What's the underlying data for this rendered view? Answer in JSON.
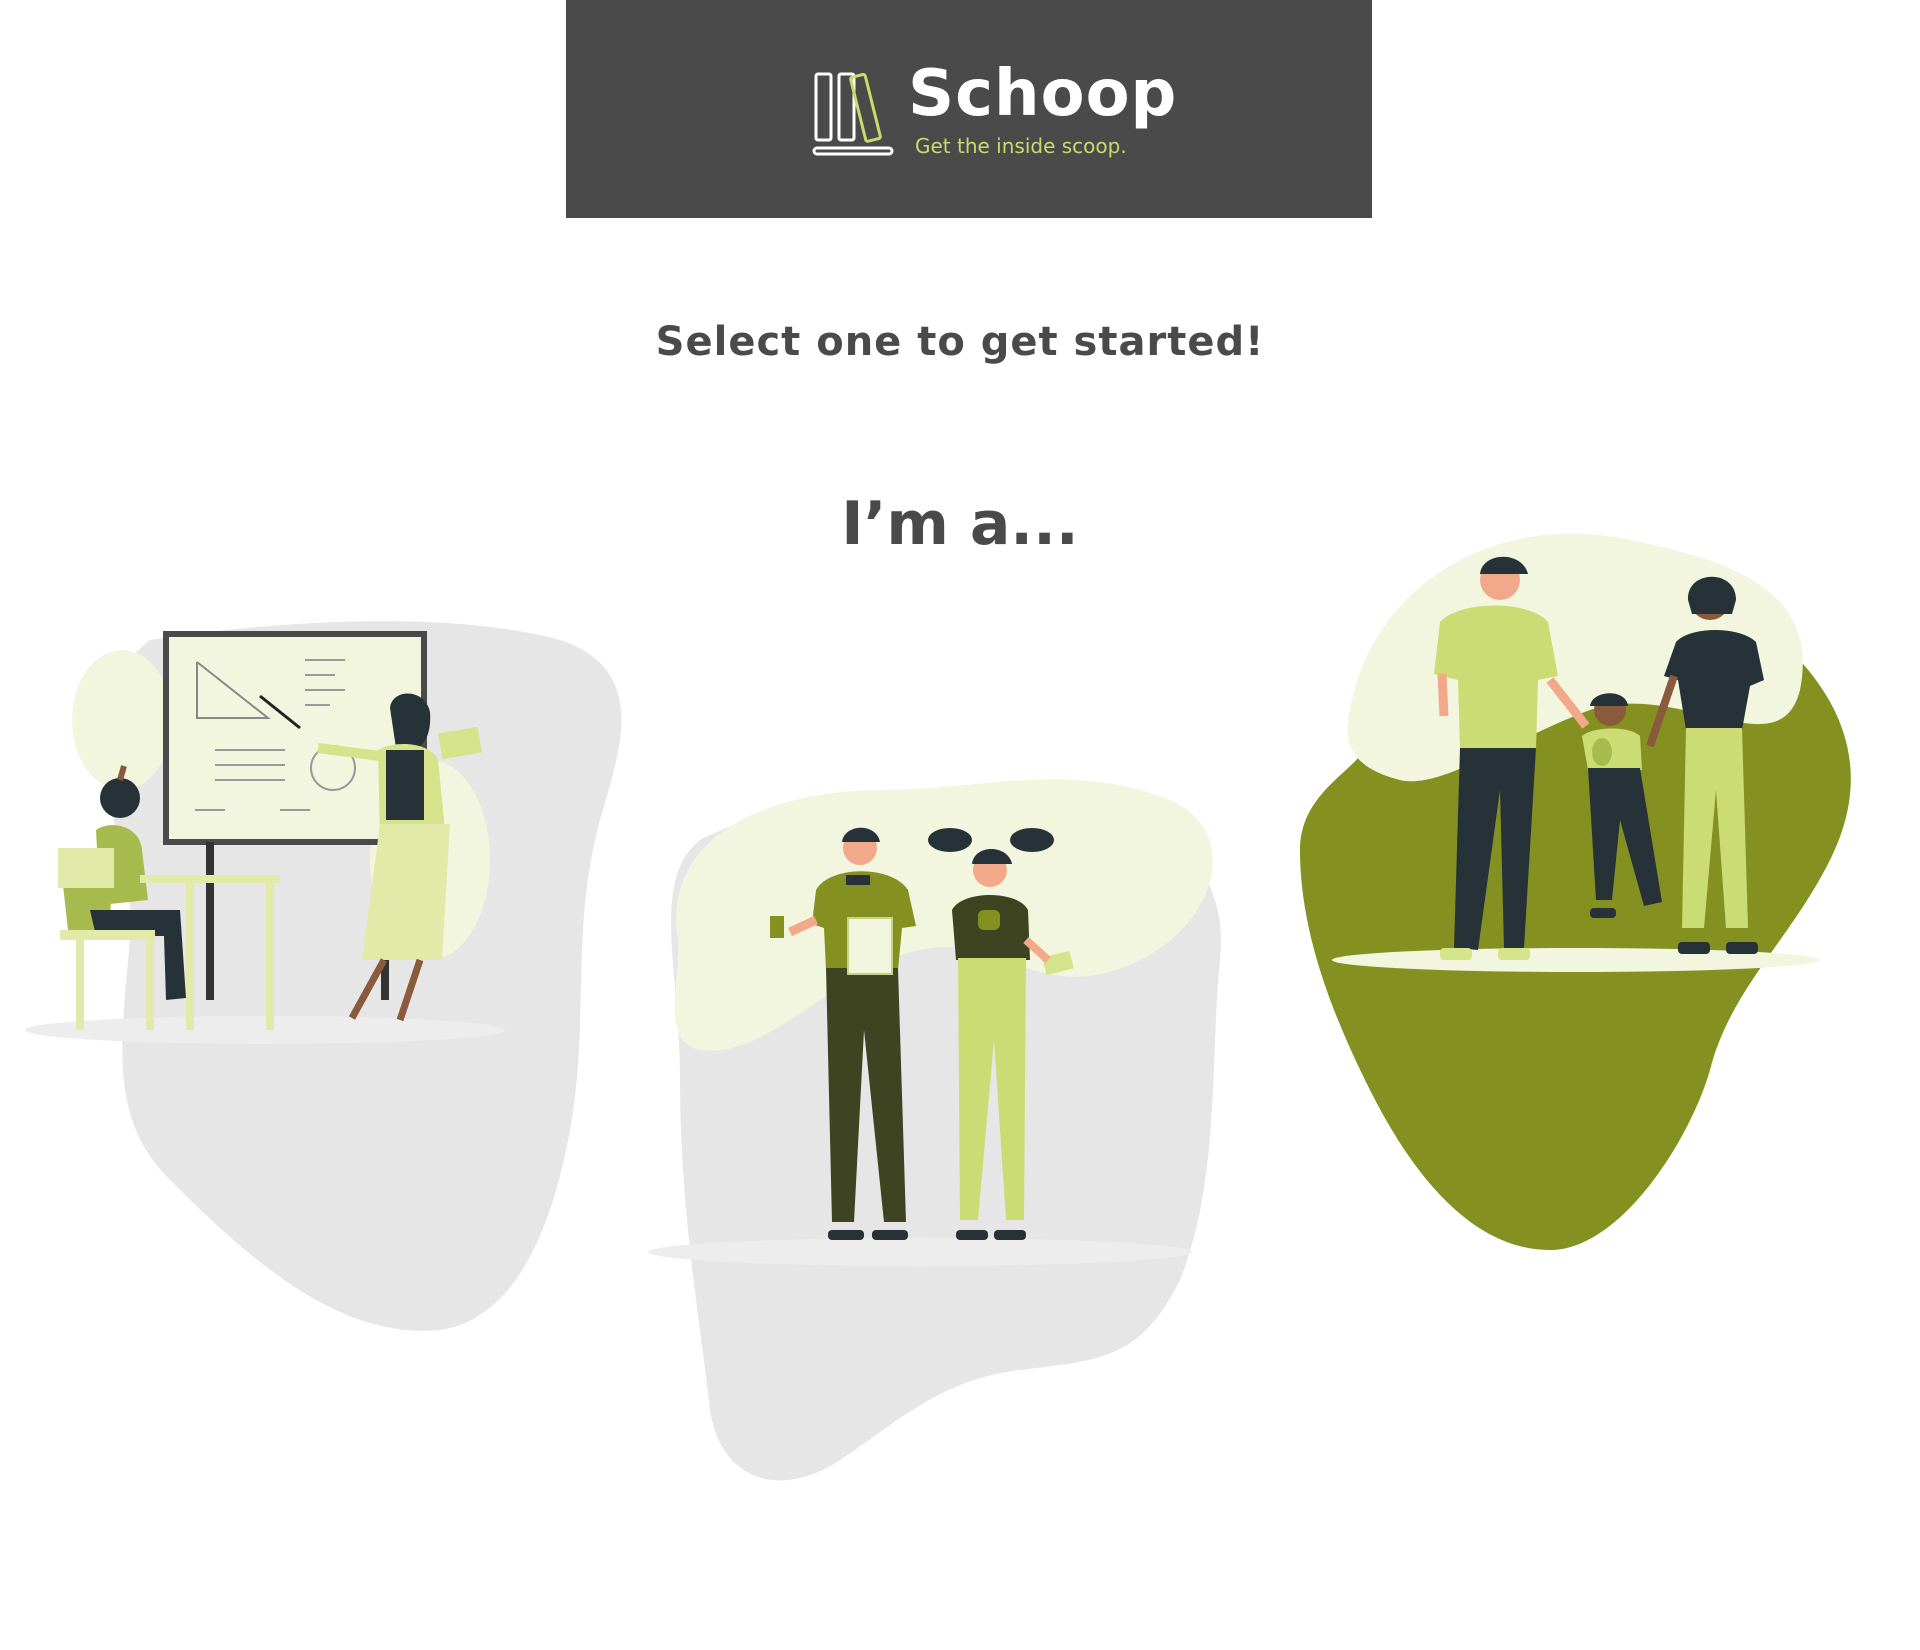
{
  "header": {
    "brand_name": "Schoop",
    "tagline": "Get the inside scoop.",
    "logo_icon": "bookshelf-logo-icon",
    "background_color": "#4a4a4a",
    "accent_color": "#c7dc6b"
  },
  "main": {
    "subtitle": "Select one to get started!",
    "prompt": "I’m a...",
    "options": [
      {
        "id": "teacher",
        "illustration": "teacher-classroom-illustration"
      },
      {
        "id": "student",
        "illustration": "students-illustration"
      },
      {
        "id": "parent",
        "illustration": "family-illustration"
      }
    ]
  },
  "colors": {
    "text_dark": "#4a4a4a",
    "blob_grey": "#e6e6e6",
    "blob_olive": "#849121",
    "light_green": "#d5e38a",
    "pale_green": "#f3f6df",
    "dark_navy": "#263238"
  }
}
